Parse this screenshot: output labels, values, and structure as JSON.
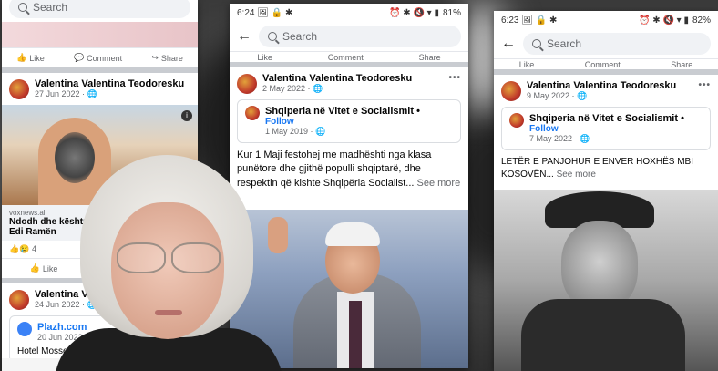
{
  "search_placeholder": "Search",
  "actions": {
    "like": "Like",
    "comment": "Comment",
    "share": "Share"
  },
  "left": {
    "post1": {
      "author": "Valentina Valentina Teodoresku",
      "date": "27 Jun 2022",
      "link_domain": "voxnews.al",
      "link_title": "Ndodh dhe kështu! Oyte",
      "link_title2": "Edi Ramën",
      "reactions": "4"
    },
    "post2": {
      "author": "Valentina Valentina",
      "date": "24 Jun 2022",
      "shared_name": "Plazh.com",
      "shared_date": "20 Jun 2022",
      "text": "Hotel Mosses"
    }
  },
  "middle": {
    "time": "6:24",
    "battery": "81%",
    "author": "Valentina Valentina Teodoresku",
    "date": "2 May 2022",
    "page_name": "Shqiperia në Vitet e Socialismit",
    "follow": "Follow",
    "page_date": "1 May 2019",
    "text": "Kur 1 Maji festohej me madhështi nga klasa punëtore dhe gjithë populli shqiptarë, dhe respektin që kishte Shqipëria Socialist...",
    "see_more": "See more"
  },
  "right": {
    "time": "6:23",
    "battery": "82%",
    "author": "Valentina Valentina Teodoresku",
    "date": "9 May 2022",
    "page_name": "Shqiperia në Vitet e Socialismit",
    "follow": "Follow",
    "page_date": "7 May 2022",
    "text": "LETËR E PANJOHUR E ENVER HOXHËS MBI KOSOVËN...",
    "see_more": "See more"
  }
}
